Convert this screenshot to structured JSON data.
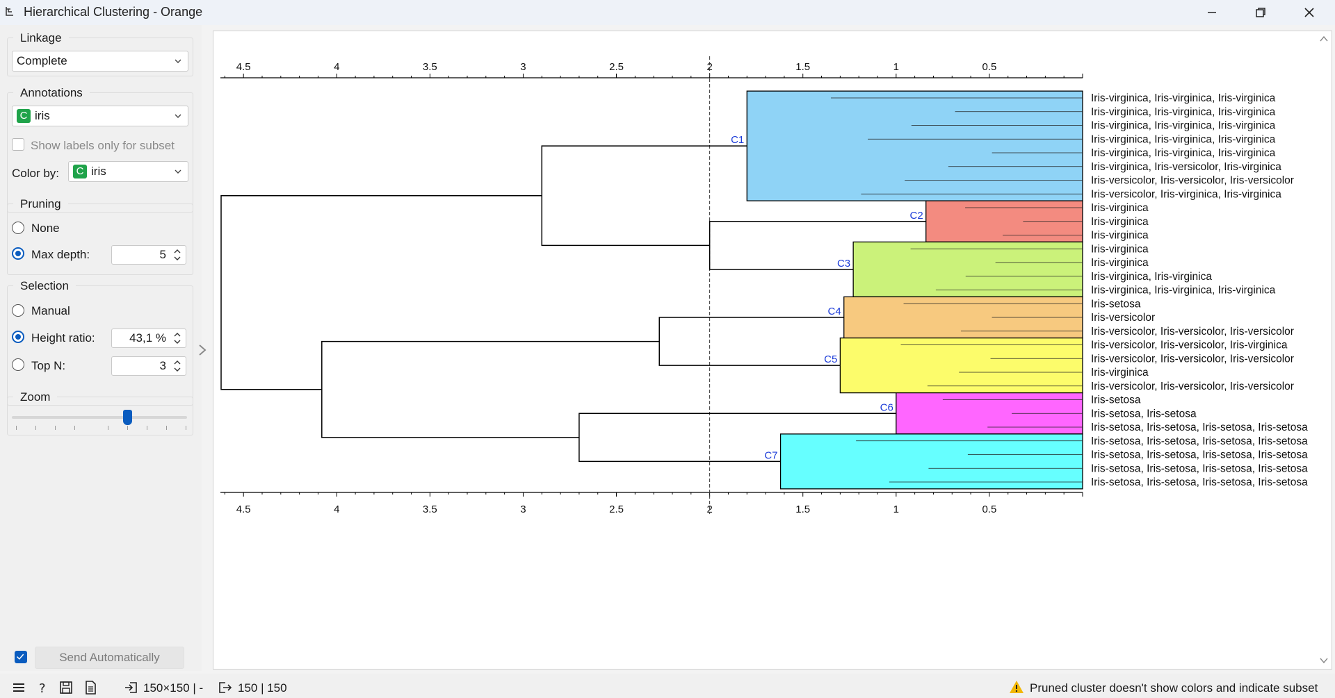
{
  "window": {
    "title": "Hierarchical Clustering - Orange"
  },
  "sidebar": {
    "linkage": {
      "title": "Linkage",
      "value": "Complete"
    },
    "annotations": {
      "title": "Annotations",
      "value": "iris",
      "badge": "C",
      "show_labels_subset": "Show labels only for subset",
      "color_by_label": "Color by:",
      "color_by_value": "iris",
      "color_by_badge": "C"
    },
    "pruning": {
      "title": "Pruning",
      "none_label": "None",
      "max_depth_label": "Max depth:",
      "max_depth_value": "5",
      "selected": "max_depth"
    },
    "selection": {
      "title": "Selection",
      "manual_label": "Manual",
      "height_ratio_label": "Height ratio:",
      "height_ratio_value": "43,1 %",
      "top_n_label": "Top N:",
      "top_n_value": "3",
      "selected": "height_ratio"
    },
    "zoom": {
      "title": "Zoom",
      "level": 0.54
    },
    "send_automatically": {
      "label": "Send Automatically",
      "checked": true
    }
  },
  "statusbar": {
    "input_summary": "150×150 | -",
    "output_summary": "150 | 150",
    "warning": "Pruned cluster doesn't show colors and indicate subset",
    "warning_color": "#f2b705"
  },
  "chart_data": {
    "type": "dendrogram",
    "axis_ticks": [
      "4.5",
      "4",
      "3.5",
      "3",
      "2.5",
      "2",
      "1.5",
      "1",
      "0.5"
    ],
    "axis_tick_values": [
      4.5,
      4,
      3.5,
      3,
      2.5,
      2,
      1.5,
      1,
      0.5
    ],
    "xlim": [
      4.62,
      0
    ],
    "cut_height": 2.0,
    "clusters": [
      {
        "name": "C1",
        "color": "#8fd3f6",
        "height": 1.8,
        "leaves": 8
      },
      {
        "name": "C2",
        "color": "#f38b80",
        "height": 0.84,
        "leaves": 3
      },
      {
        "name": "C3",
        "color": "#cbf27a",
        "height": 1.23,
        "leaves": 4
      },
      {
        "name": "C4",
        "color": "#f7c97f",
        "height": 1.28,
        "leaves": 3
      },
      {
        "name": "C5",
        "color": "#fcfc6b",
        "height": 1.3,
        "leaves": 4
      },
      {
        "name": "C6",
        "color": "#ff66ff",
        "height": 1.0,
        "leaves": 3
      },
      {
        "name": "C7",
        "color": "#66ffff",
        "height": 1.62,
        "leaves": 4
      }
    ],
    "internal_merges": [
      {
        "children": [
          "C2",
          "C3"
        ],
        "height": 2.0
      },
      {
        "children": [
          "C1",
          "C2+C3"
        ],
        "height": 2.9
      },
      {
        "children": [
          "C4",
          "C5"
        ],
        "height": 2.27
      },
      {
        "children": [
          "C6",
          "C7"
        ],
        "height": 2.7
      },
      {
        "children": [
          "C4+C5",
          "C6+C7"
        ],
        "height": 4.08
      },
      {
        "children": [
          "top",
          "bottom"
        ],
        "height": 4.62
      }
    ],
    "leaf_labels": [
      "Iris-virginica, Iris-virginica, Iris-virginica",
      "Iris-virginica, Iris-virginica, Iris-virginica",
      "Iris-virginica, Iris-virginica, Iris-virginica",
      "Iris-virginica, Iris-virginica, Iris-virginica",
      "Iris-virginica, Iris-virginica, Iris-virginica",
      "Iris-virginica, Iris-versicolor, Iris-virginica",
      "Iris-versicolor, Iris-versicolor, Iris-versicolor",
      "Iris-versicolor, Iris-virginica, Iris-virginica",
      "Iris-virginica",
      "Iris-virginica",
      "Iris-virginica",
      "Iris-virginica",
      "Iris-virginica",
      "Iris-virginica, Iris-virginica",
      "Iris-virginica, Iris-virginica, Iris-virginica",
      "Iris-setosa",
      "Iris-versicolor",
      "Iris-versicolor, Iris-versicolor, Iris-versicolor",
      "Iris-versicolor, Iris-versicolor, Iris-virginica",
      "Iris-versicolor, Iris-versicolor, Iris-versicolor",
      "Iris-virginica",
      "Iris-versicolor, Iris-versicolor, Iris-versicolor",
      "Iris-setosa",
      "Iris-setosa, Iris-setosa",
      "Iris-setosa, Iris-setosa, Iris-setosa, Iris-setosa",
      "Iris-setosa, Iris-setosa, Iris-setosa, Iris-setosa",
      "Iris-setosa, Iris-setosa, Iris-setosa, Iris-setosa",
      "Iris-setosa, Iris-setosa, Iris-setosa, Iris-setosa",
      "Iris-setosa, Iris-setosa, Iris-setosa, Iris-setosa"
    ]
  }
}
